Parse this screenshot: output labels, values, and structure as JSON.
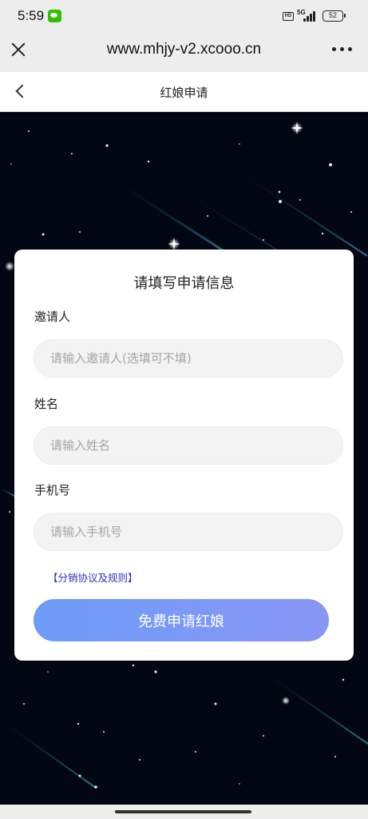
{
  "status_bar": {
    "time": "5:59",
    "network": "5G",
    "hd": "HD",
    "battery": "52"
  },
  "browser": {
    "url": "www.mhjy-v2.xcooo.cn"
  },
  "header": {
    "title": "红娘申请"
  },
  "form": {
    "title": "请填写申请信息",
    "inviter_label": "邀请人",
    "inviter_placeholder": "请输入邀请人(选填可不填)",
    "name_label": "姓名",
    "name_placeholder": "请输入姓名",
    "phone_label": "手机号",
    "phone_placeholder": "请输入手机号",
    "agreement_link": "【分销协议及规则】",
    "submit_label": "免费申请红娘"
  },
  "colors": {
    "accent": "#7b9af6",
    "link": "#2a32c0",
    "background": "#020612"
  }
}
